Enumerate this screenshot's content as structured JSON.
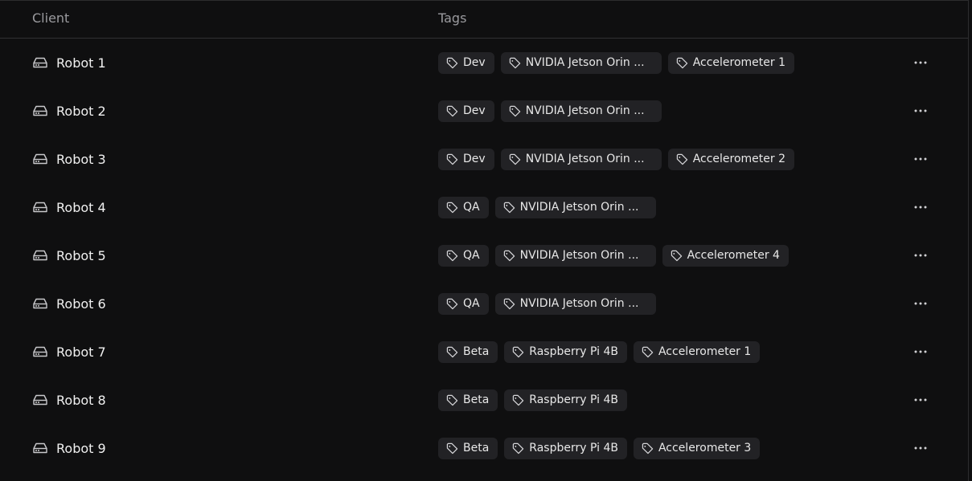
{
  "header": {
    "client": "Client",
    "tags": "Tags"
  },
  "icons": {
    "client": "server-drive-icon",
    "tag": "tag-icon",
    "more": "more-horizontal-icon"
  },
  "rows": [
    {
      "name": "Robot 1",
      "tags": [
        "Dev",
        "NVIDIA Jetson Orin ...",
        "Accelerometer 1"
      ]
    },
    {
      "name": "Robot 2",
      "tags": [
        "Dev",
        "NVIDIA Jetson Orin ..."
      ]
    },
    {
      "name": "Robot 3",
      "tags": [
        "Dev",
        "NVIDIA Jetson Orin ...",
        "Accelerometer 2"
      ]
    },
    {
      "name": "Robot 4",
      "tags": [
        "QA",
        "NVIDIA Jetson Orin ..."
      ]
    },
    {
      "name": "Robot 5",
      "tags": [
        "QA",
        "NVIDIA Jetson Orin ...",
        "Accelerometer 4"
      ]
    },
    {
      "name": "Robot 6",
      "tags": [
        "QA",
        "NVIDIA Jetson Orin ..."
      ]
    },
    {
      "name": "Robot 7",
      "tags": [
        "Beta",
        "Raspberry Pi 4B",
        "Accelerometer 1"
      ]
    },
    {
      "name": "Robot 8",
      "tags": [
        "Beta",
        "Raspberry Pi 4B"
      ]
    },
    {
      "name": "Robot 9",
      "tags": [
        "Beta",
        "Raspberry Pi 4B",
        "Accelerometer 3"
      ]
    }
  ]
}
